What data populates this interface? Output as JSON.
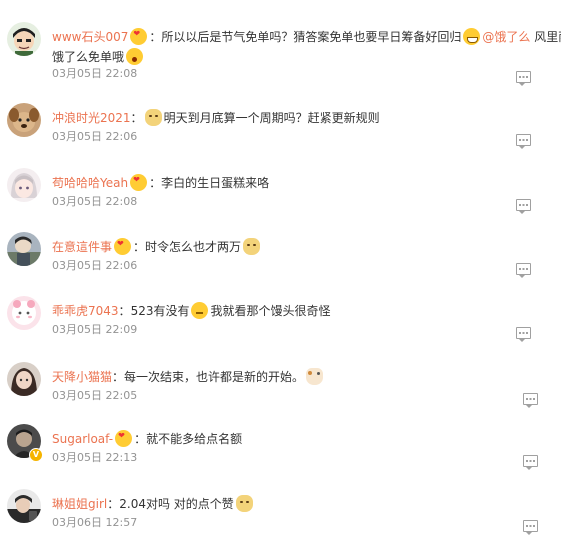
{
  "comments": [
    {
      "username": "www石头007",
      "text_part1": "所以以后是节气免单吗？猜答案免单也要早日筹备好回归",
      "mention": "@饿了么",
      "text_part2": " 风里雨",
      "line2": "饿了么免单哦",
      "time": "03月05日 22:08"
    },
    {
      "username": "冲浪时光2021",
      "text": "明天到月底算一个周期吗？赶紧更新规则",
      "time": "03月05日 22:06"
    },
    {
      "username": "苟哈哈哈Yeah",
      "text": "李白的生日蛋糕来咯",
      "time": "03月05日 22:08"
    },
    {
      "username": "在意這件事",
      "text": "时令怎么也才两万",
      "time": "03月05日 22:06"
    },
    {
      "username": "乖乖虎7043",
      "text_part1": "523有没有",
      "text_part2": "我就看那个馒头很奇怪",
      "time": "03月05日 22:09"
    },
    {
      "username": "天降小猫猫",
      "text": "每一次结束，也许都是新的开始。",
      "time": "03月05日 22:05"
    },
    {
      "username": "Sugarloaf-",
      "text": "就不能多给点名额",
      "time": "03月05日 22:13"
    },
    {
      "username": "琳姐姐girl",
      "text": "2.04对吗 对的点个赞",
      "time": "03月06日 12:57"
    }
  ],
  "colon": "：",
  "icons": {
    "reply": "comment-reply-icon",
    "verified": "verified-badge-icon",
    "emoji_dog": "dog-emoji-icon",
    "emoji_cry": "crying-emoji-icon",
    "emoji_grin": "grin-emoji-icon",
    "emoji_think": "thinking-emoji-icon",
    "emoji_cat": "cat-emoji-icon",
    "emoji_wow": "surprised-emoji-icon",
    "emoji_heart": "heart-emoji-icon"
  },
  "colors": {
    "username": "#eb7350",
    "text": "#333333",
    "time": "#939393",
    "icon": "#a0a0a0"
  }
}
